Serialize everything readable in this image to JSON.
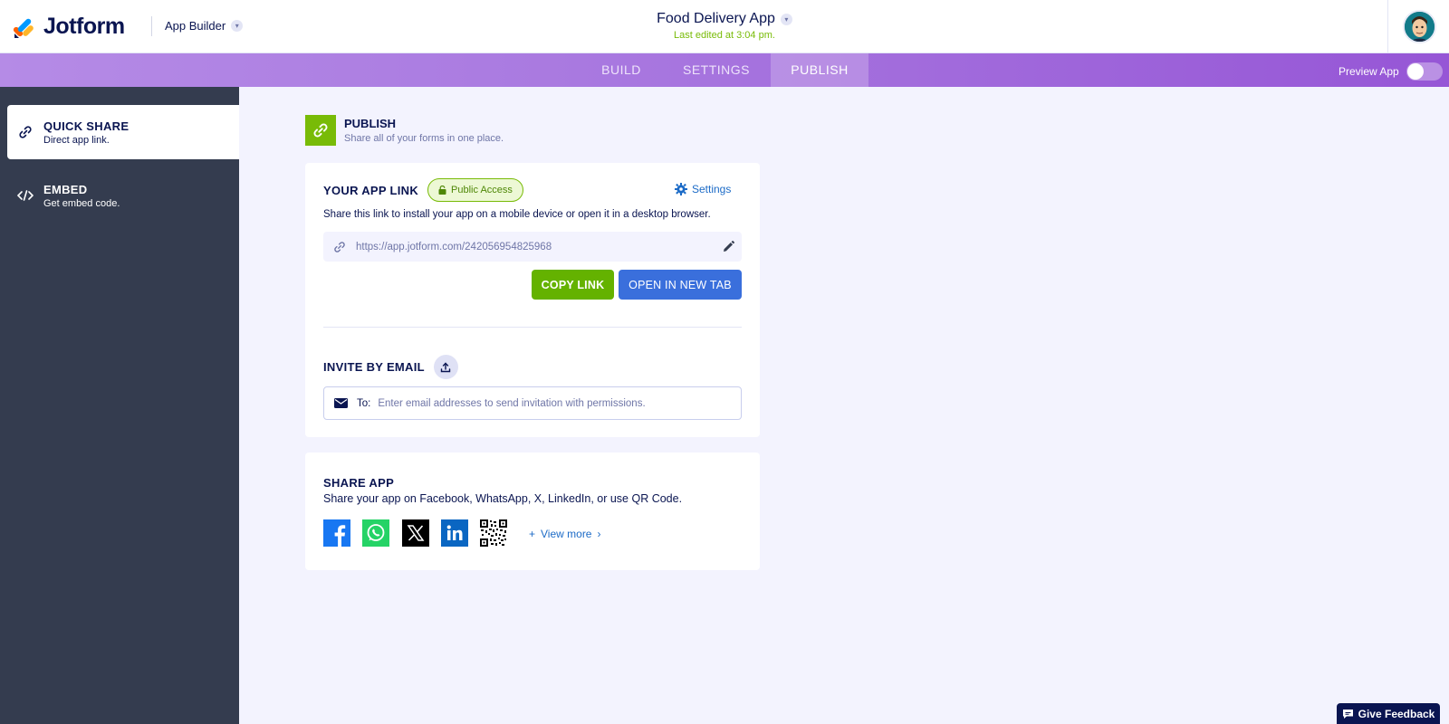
{
  "brand": {
    "name": "Jotform",
    "product": "App Builder"
  },
  "header": {
    "app_title": "Food Delivery App",
    "last_edited": "Last edited at 3:04 pm."
  },
  "tabs": {
    "build": "BUILD",
    "settings": "SETTINGS",
    "publish": "PUBLISH"
  },
  "preview": {
    "label": "Preview App",
    "enabled": false
  },
  "sidebar": {
    "items": [
      {
        "title": "QUICK SHARE",
        "subtitle": "Direct app link.",
        "icon": "link-icon",
        "active": true
      },
      {
        "title": "EMBED",
        "subtitle": "Get embed code.",
        "icon": "code-icon",
        "active": false
      }
    ]
  },
  "publish": {
    "title": "PUBLISH",
    "subtitle": "Share all of your forms in one place."
  },
  "app_link": {
    "title": "YOUR APP LINK",
    "badge": "Public Access",
    "settings_label": "Settings",
    "description": "Share this link to install your app on a mobile device or open it in a desktop browser.",
    "url": "https://app.jotform.com/242056954825968",
    "copy_label": "COPY LINK",
    "open_label": "OPEN IN NEW TAB"
  },
  "invite": {
    "title": "INVITE BY EMAIL",
    "to_label": "To:",
    "placeholder": "Enter email addresses to send invitation with permissions."
  },
  "share_app": {
    "title": "SHARE APP",
    "description": "Share your app on Facebook, WhatsApp, X, LinkedIn, or use QR Code.",
    "view_more": "View more",
    "networks": [
      "facebook",
      "whatsapp",
      "x",
      "linkedin",
      "qr-code"
    ]
  },
  "feedback": {
    "label": "Give Feedback"
  },
  "colors": {
    "navy": "#0a1551",
    "green": "#64b200",
    "blue": "#3a6fdc",
    "sidebar": "#343c4f",
    "purple": "#9656d6"
  }
}
